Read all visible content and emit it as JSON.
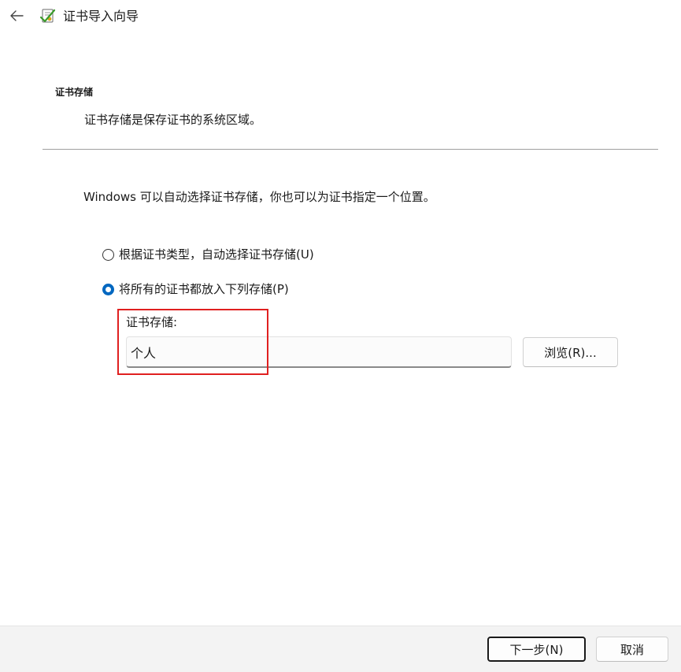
{
  "window": {
    "title": "证书导入向导",
    "back_icon": "arrow-left-icon",
    "wizard_icon": "certificate-wizard-icon"
  },
  "header": {
    "section_title": "证书存储",
    "section_description": "证书存储是保存证书的系统区域。"
  },
  "main": {
    "instruction": "Windows 可以自动选择证书存储，你也可以为证书指定一个位置。",
    "options": [
      {
        "label": "根据证书类型，自动选择证书存储(U)",
        "selected": false
      },
      {
        "label": "将所有的证书都放入下列存储(P)",
        "selected": true
      }
    ],
    "store_label": "证书存储:",
    "store_value": "个人",
    "browse_label": "浏览(R)...",
    "highlight_color": "#e02020"
  },
  "footer": {
    "next_label": "下一步(N)",
    "cancel_label": "取消"
  },
  "colors": {
    "accent": "#0067c0",
    "footer_bg": "#f3f3f3",
    "divider": "#a0a0a0"
  }
}
